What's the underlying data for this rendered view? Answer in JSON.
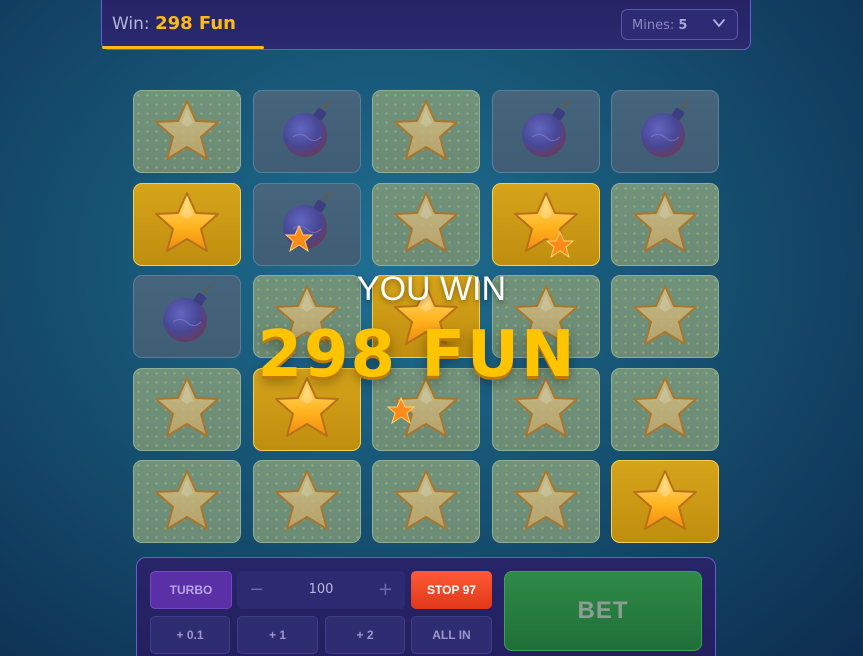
{
  "header": {
    "win_label": "Win:",
    "win_value": "298 Fun",
    "mines_label": "Mines:",
    "mines_value": "5"
  },
  "board": {
    "rows": [
      [
        "star",
        "bomb",
        "star",
        "bomb",
        "bomb"
      ],
      [
        "picked",
        "bomb",
        "star",
        "picked",
        "star"
      ],
      [
        "bomb",
        "star",
        "picked",
        "star",
        "star"
      ],
      [
        "star",
        "picked",
        "star",
        "star",
        "star"
      ],
      [
        "star",
        "star",
        "star",
        "star",
        "picked"
      ]
    ]
  },
  "overlay": {
    "title": "YOU WIN",
    "amount": "298  FUN"
  },
  "controls": {
    "turbo_label": "TURBO",
    "stake_minus": "−",
    "stake_value": "100",
    "stake_plus": "+",
    "stop_label": "STOP 97",
    "bet_label": "BET",
    "quick_bets": [
      "+ 0.1",
      "+ 1",
      "+ 2",
      "ALL IN"
    ]
  },
  "colors": {
    "accent_gold": "#ffb914",
    "stop_red": "#e0371a",
    "bet_green": "#2f8a47",
    "turbo_purple": "#5b2fa6"
  }
}
